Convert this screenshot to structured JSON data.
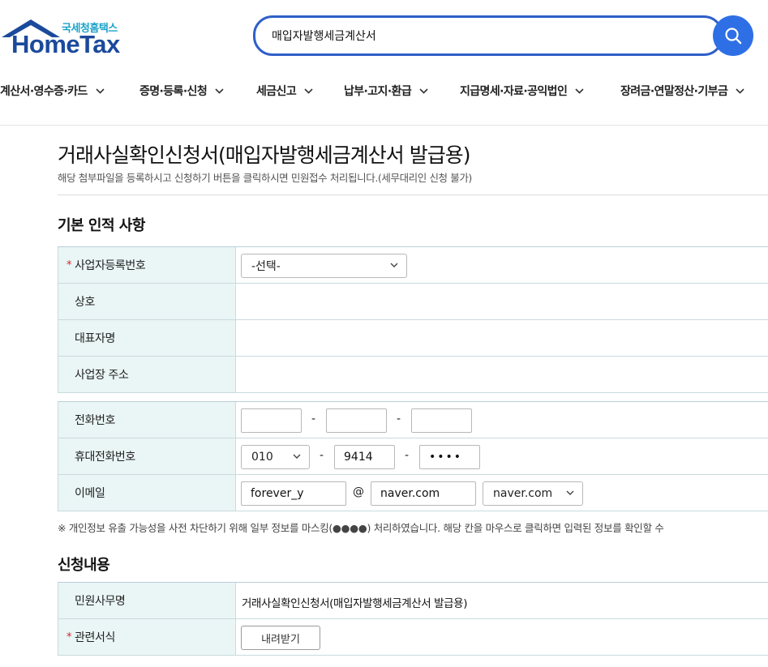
{
  "header": {
    "logo_small": "국세청홈택스",
    "logo_big": "HomeTax",
    "search_value": "매입자발행세금계산서",
    "colors": {
      "brand": "#1b4a9c",
      "accent": "#2f6fe6",
      "logo_small": "#1aa3c9"
    }
  },
  "nav": {
    "items": [
      {
        "label": "계산서·영수증·카드"
      },
      {
        "label": "증명·등록·신청"
      },
      {
        "label": "세금신고"
      },
      {
        "label": "납부·고지·환급"
      },
      {
        "label": "지급명세·자료·공익법인"
      },
      {
        "label": "장려금·연말정산·기부금"
      }
    ]
  },
  "page": {
    "title": "거래사실확인신청서(매입자발행세금계산서 발급용)",
    "description": "해당 첨부파일을 등록하시고 신청하기 버튼을 클릭하시면 민원접수 처리됩니다.(세무대리인 신청 불가)"
  },
  "basic": {
    "section_title": "기본 인적 사항",
    "biz_no_label": "사업자등록번호",
    "biz_no_select": "-선택-",
    "company_label": "상호",
    "ceo_label": "대표자명",
    "address_label": "사업장 주소",
    "required_mark": "*"
  },
  "contact": {
    "phone_label": "전화번호",
    "phone": [
      "",
      "",
      ""
    ],
    "mobile_label": "휴대전화번호",
    "mobile_prefix": "010",
    "mobile_mid": "9414",
    "mobile_last": "••••",
    "email_label": "이메일",
    "email_id": "forever_y",
    "email_at": "@",
    "email_domain": "naver.com",
    "email_domain_select": "naver.com",
    "dash": "-"
  },
  "notice": "※ 개인정보 유출 가능성을 사전 차단하기 위해 일부 정보를 마스킹(●●●●) 처리하였습니다. 해당 칸을 마우스로 클릭하면 입력된 정보를 확인할 수",
  "request": {
    "section_title": "신청내용",
    "service_label": "민원사무명",
    "service_value": "거래사실확인신청서(매입자발행세금계산서 발급용)",
    "form_label": "관련서식",
    "download_label": "내려받기"
  }
}
